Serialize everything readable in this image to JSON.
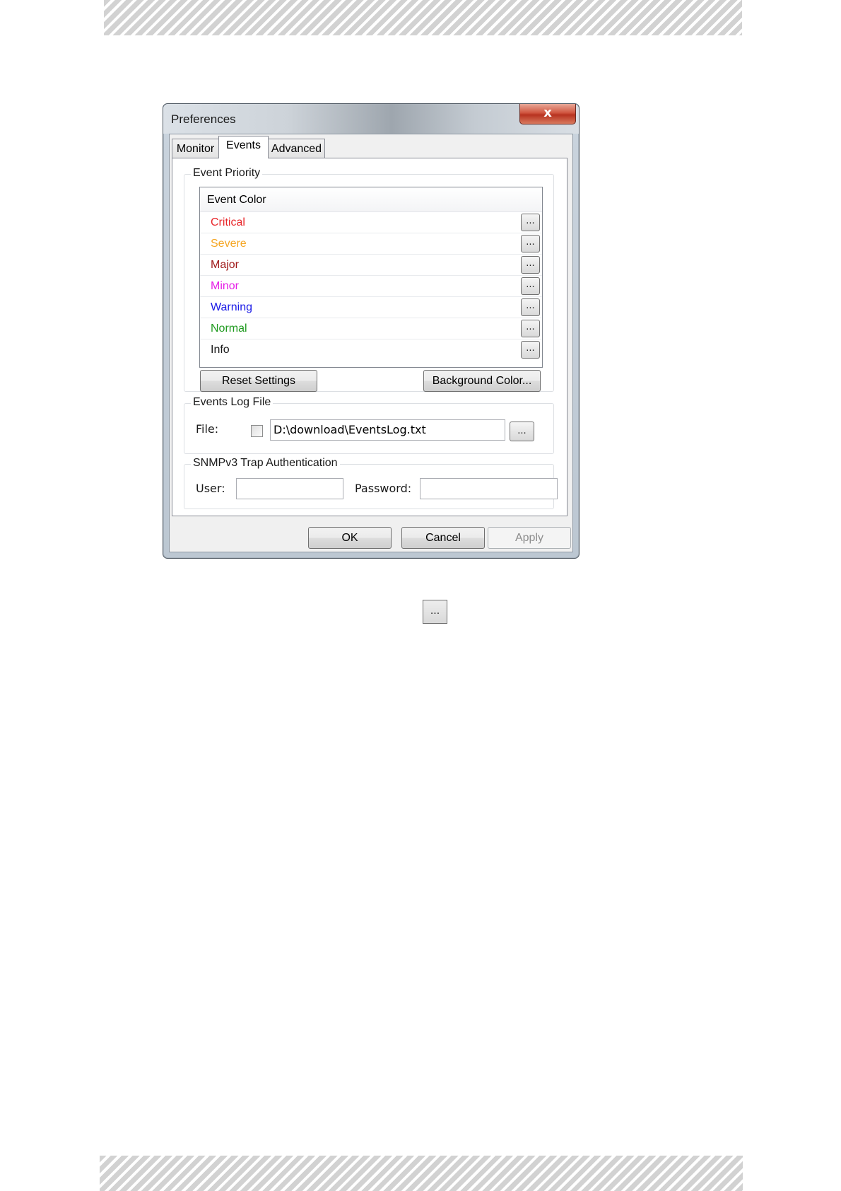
{
  "dialog": {
    "title": "Preferences",
    "close_label": "x",
    "tabs": [
      {
        "label": "Monitor"
      },
      {
        "label": "Events"
      },
      {
        "label": "Advanced"
      }
    ],
    "active_tab": "Events"
  },
  "event_priority": {
    "group_label": "Event Priority",
    "column_header": "Event Color",
    "items": [
      {
        "label": "Critical",
        "color": "#e8262a",
        "button": "..."
      },
      {
        "label": "Severe",
        "color": "#f5a623",
        "button": "..."
      },
      {
        "label": "Major",
        "color": "#a01a1a",
        "button": "..."
      },
      {
        "label": "Minor",
        "color": "#e61ee6",
        "button": "..."
      },
      {
        "label": "Warning",
        "color": "#1a1ae6",
        "button": "..."
      },
      {
        "label": "Normal",
        "color": "#1f9a1f",
        "button": "..."
      },
      {
        "label": "Info",
        "color": "#1a1a1a",
        "button": "..."
      }
    ],
    "reset_button": "Reset Settings",
    "background_button": "Background Color..."
  },
  "events_log": {
    "group_label": "Events Log File",
    "file_label": "File:",
    "file_value": "D:\\download\\EventsLog.txt",
    "checkbox_checked": false,
    "browse_button": "..."
  },
  "snmp": {
    "group_label": "SNMPv3 Trap Authentication",
    "user_label": "User:",
    "user_value": "",
    "password_label": "Password:",
    "password_value": ""
  },
  "footer": {
    "ok": "OK",
    "cancel": "Cancel",
    "apply": "Apply"
  },
  "below_dialog_button": "..."
}
